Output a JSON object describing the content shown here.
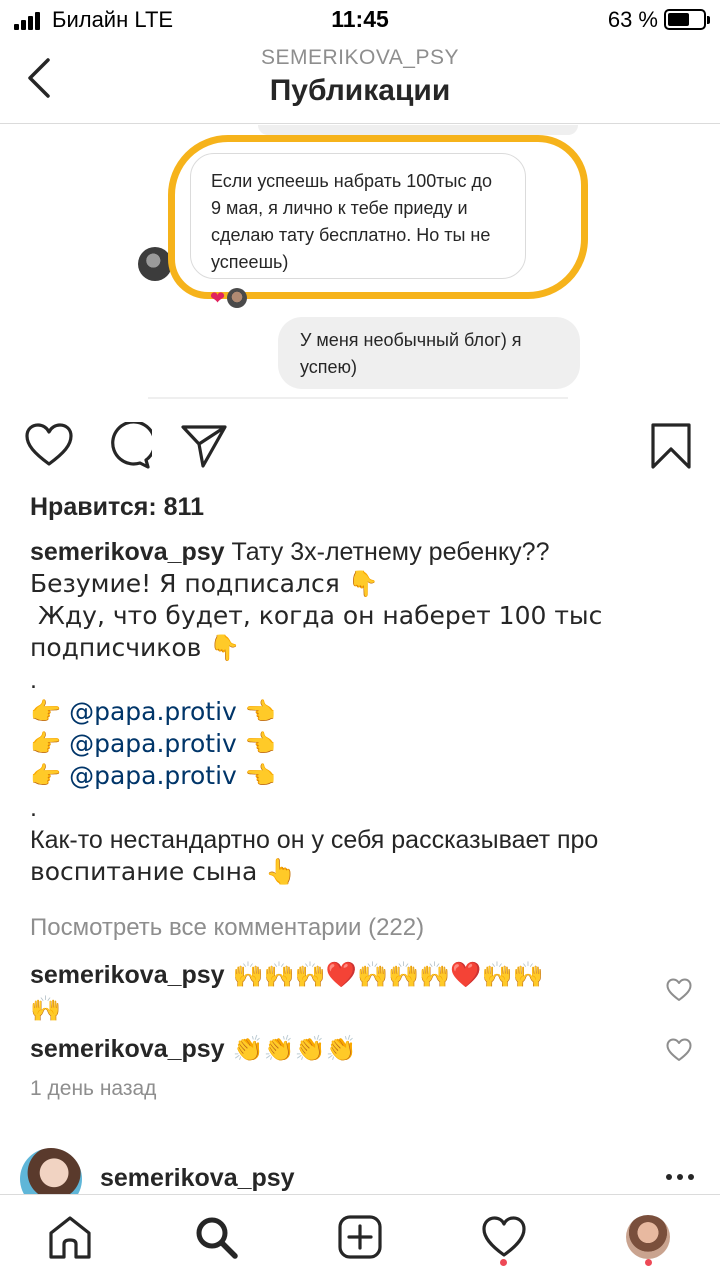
{
  "status_bar": {
    "carrier": "Билайн  LTE",
    "time": "11:45",
    "battery_text": "63 %",
    "battery_level": 0.63
  },
  "header": {
    "username": "SEMERIKOVA_PSY",
    "title": "Публикации"
  },
  "post_image": {
    "incoming_message": "Если успеешь набрать 100тыс до 9 мая, я лично к тебе приеду и сделаю тату бесплатно. Но ты не успеешь)",
    "reaction": "❤",
    "outgoing_message": "У меня необычный блог) я успею)",
    "highlight_color": "#f6b31b"
  },
  "actions": {
    "like": "heart-icon",
    "comment": "comment-icon",
    "share": "send-icon",
    "save": "bookmark-icon"
  },
  "likes_text": "Нравится: 811",
  "caption": {
    "username": "semerikova_psy",
    "line1": " Тату 3х-летнему ребенку??",
    "line2": "Безумие! Я подписался 👇",
    "line3": " Жду, что будет, когда он наберет 100 тыс",
    "line4": "подписчиков 👇",
    "dot": ".",
    "mention_prefix": "👉 ",
    "mention": "@papa.protiv",
    "mention_suffix": " 👈",
    "line_last1": "Как-то нестандартно он у себя рассказывает про",
    "line_last2": "воспитание сына 👆"
  },
  "view_all_comments": "Посмотреть все комментарии (222)",
  "comments": [
    {
      "username": "semerikova_psy",
      "text": " 🙌🙌🙌❤️🙌🙌🙌❤️🙌🙌",
      "text2": "🙌"
    },
    {
      "username": "semerikova_psy",
      "text": " 👏👏👏👏"
    }
  ],
  "timestamp": "1 день назад",
  "next_post": {
    "username": "semerikova_psy"
  },
  "tabbar": {
    "items": [
      "home-icon",
      "search-icon",
      "add-icon",
      "activity-icon",
      "profile-icon"
    ],
    "notification_color": "#ed4956"
  }
}
